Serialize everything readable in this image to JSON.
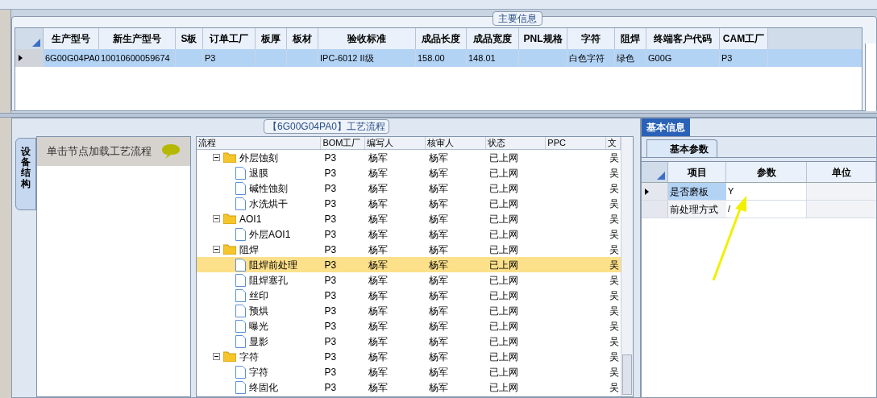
{
  "main_info": {
    "title": "主要信息",
    "columns": [
      "生产型号",
      "新生产型号",
      "S板",
      "订单工厂",
      "板厚",
      "板材",
      "验收标准",
      "成品长度",
      "成品宽度",
      "PNL规格",
      "字符",
      "阻焊",
      "终端客户代码",
      "CAM工厂"
    ],
    "rows": [
      {
        "selected": true,
        "cells": [
          "6G00G04PA0",
          "10010600059674",
          null,
          "P3",
          null,
          null,
          "IPC-6012 II级",
          "158.00",
          "148.01",
          null,
          "白色字符",
          "绿色",
          "G00G",
          "P3"
        ]
      }
    ]
  },
  "process_flow": {
    "title": "【6G00G04PA0】工艺流程",
    "side_tab": "设备结构",
    "hint": "单击节点加载工艺流程",
    "columns": [
      "流程",
      "BOM工厂",
      "编写人",
      "核审人",
      "状态",
      "PPC",
      "文"
    ],
    "tree": [
      {
        "name": "外层蚀刻",
        "expanded": true,
        "selected": false,
        "bom": "P3",
        "writer": "杨军",
        "reviewer": "杨军",
        "status": "已上网",
        "doc": "吴",
        "children": [
          {
            "name": "退膜",
            "selected": false,
            "bom": "P3",
            "writer": "杨军",
            "reviewer": "杨军",
            "status": "已上网",
            "doc": "吴"
          },
          {
            "name": "碱性蚀刻",
            "selected": false,
            "bom": "P3",
            "writer": "杨军",
            "reviewer": "杨军",
            "status": "已上网",
            "doc": "吴"
          },
          {
            "name": "水洗烘干",
            "selected": false,
            "bom": "P3",
            "writer": "杨军",
            "reviewer": "杨军",
            "status": "已上网",
            "doc": "吴"
          }
        ]
      },
      {
        "name": "AOI1",
        "expanded": true,
        "selected": false,
        "bom": "P3",
        "writer": "杨军",
        "reviewer": "杨军",
        "status": "已上网",
        "doc": "吴",
        "children": [
          {
            "name": "外层AOI1",
            "selected": false,
            "bom": "P3",
            "writer": "杨军",
            "reviewer": "杨军",
            "status": "已上网",
            "doc": "吴"
          }
        ]
      },
      {
        "name": "阻焊",
        "expanded": true,
        "selected": false,
        "bom": "P3",
        "writer": "杨军",
        "reviewer": "杨军",
        "status": "已上网",
        "doc": "吴",
        "children": [
          {
            "name": "阻焊前处理",
            "selected": true,
            "bom": "P3",
            "writer": "杨军",
            "reviewer": "杨军",
            "status": "已上网",
            "doc": "吴"
          },
          {
            "name": "阻焊塞孔",
            "selected": false,
            "bom": "P3",
            "writer": "杨军",
            "reviewer": "杨军",
            "status": "已上网",
            "doc": "吴"
          },
          {
            "name": "丝印",
            "selected": false,
            "bom": "P3",
            "writer": "杨军",
            "reviewer": "杨军",
            "status": "已上网",
            "doc": "吴"
          },
          {
            "name": "预烘",
            "selected": false,
            "bom": "P3",
            "writer": "杨军",
            "reviewer": "杨军",
            "status": "已上网",
            "doc": "吴"
          },
          {
            "name": "曝光",
            "selected": false,
            "bom": "P3",
            "writer": "杨军",
            "reviewer": "杨军",
            "status": "已上网",
            "doc": "吴"
          },
          {
            "name": "显影",
            "selected": false,
            "bom": "P3",
            "writer": "杨军",
            "reviewer": "杨军",
            "status": "已上网",
            "doc": "吴"
          }
        ]
      },
      {
        "name": "字符",
        "expanded": true,
        "selected": false,
        "bom": "P3",
        "writer": "杨军",
        "reviewer": "杨军",
        "status": "已上网",
        "doc": "吴",
        "children": [
          {
            "name": "字符",
            "selected": false,
            "bom": "P3",
            "writer": "杨军",
            "reviewer": "杨军",
            "status": "已上网",
            "doc": "吴"
          },
          {
            "name": "终固化",
            "selected": false,
            "bom": "P3",
            "writer": "杨军",
            "reviewer": "杨军",
            "status": "已上网",
            "doc": "吴"
          }
        ]
      }
    ]
  },
  "basic_info": {
    "tabs": [
      {
        "label": "基本信息",
        "selected": true
      }
    ],
    "subtabs": [
      {
        "label": "基本参数",
        "selected": true
      }
    ],
    "columns": [
      "项目",
      "参数",
      "单位"
    ],
    "rows": [
      {
        "item": "是否磨板",
        "value": "Y",
        "selected": true
      },
      {
        "item": "前处理方式",
        "value": "/",
        "selected": false
      }
    ]
  }
}
